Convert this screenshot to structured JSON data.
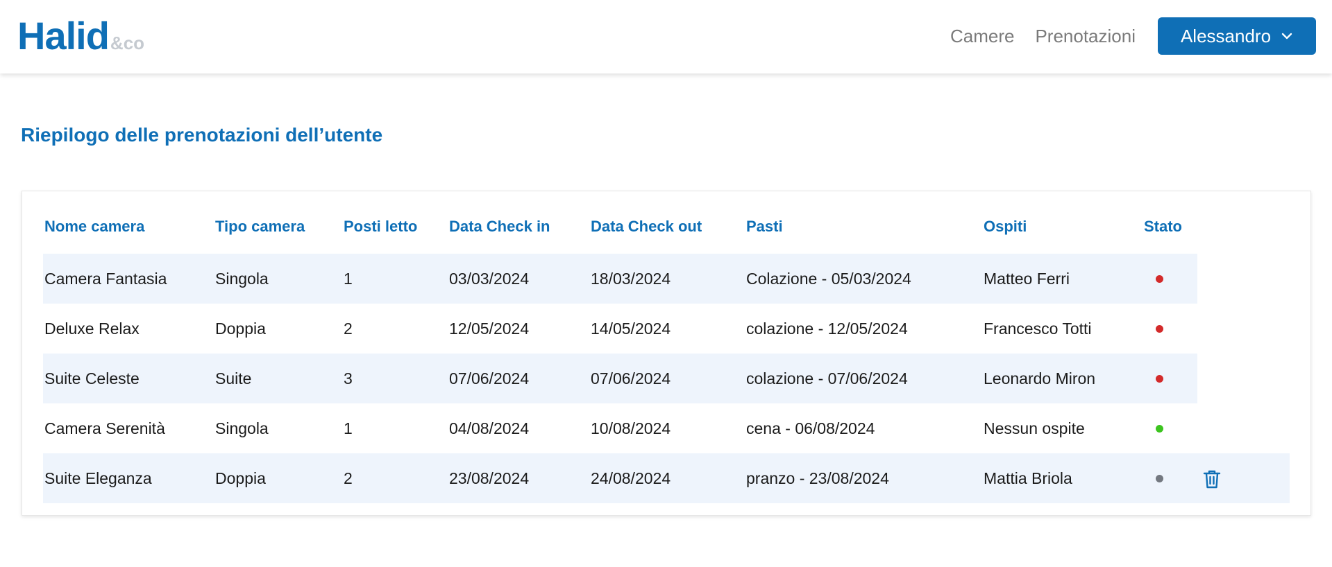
{
  "header": {
    "logo_main": "Halid",
    "logo_suffix": "&co",
    "nav": {
      "camere": "Camere",
      "prenotazioni": "Prenotazioni"
    },
    "user_menu_label": "Alessandro",
    "brand_color": "#0f6fb6"
  },
  "page": {
    "title": "Riepilogo delle prenotazioni dell’utente"
  },
  "table": {
    "columns": [
      "Nome camera",
      "Tipo camera",
      "Posti letto",
      "Data Check in",
      "Data Check out",
      "Pasti",
      "Ospiti",
      "Stato"
    ],
    "rows": [
      {
        "nome": "Camera Fantasia",
        "tipo": "Singola",
        "posti": "1",
        "checkin": "03/03/2024",
        "checkout": "18/03/2024",
        "pasti": "Colazione - 05/03/2024",
        "ospiti": "Matteo Ferri",
        "status_color": "#d32a2a",
        "deletable": false
      },
      {
        "nome": "Deluxe Relax",
        "tipo": "Doppia",
        "posti": "2",
        "checkin": "12/05/2024",
        "checkout": "14/05/2024",
        "pasti": "colazione - 12/05/2024",
        "ospiti": "Francesco Totti",
        "status_color": "#d32a2a",
        "deletable": false
      },
      {
        "nome": "Suite Celeste",
        "tipo": "Suite",
        "posti": "3",
        "checkin": "07/06/2024",
        "checkout": "07/06/2024",
        "pasti": "colazione - 07/06/2024",
        "ospiti": "Leonardo Miron",
        "status_color": "#d32a2a",
        "deletable": false
      },
      {
        "nome": "Camera Serenità",
        "tipo": "Singola",
        "posti": "1",
        "checkin": "04/08/2024",
        "checkout": "10/08/2024",
        "pasti": "cena - 06/08/2024",
        "ospiti": "Nessun ospite",
        "status_color": "#3cc41f",
        "deletable": false
      },
      {
        "nome": "Suite Eleganza",
        "tipo": "Doppia",
        "posti": "2",
        "checkin": "23/08/2024",
        "checkout": "24/08/2024",
        "pasti": "pranzo - 23/08/2024",
        "ospiti": "Mattia Briola",
        "status_color": "#737880",
        "deletable": true
      }
    ]
  }
}
